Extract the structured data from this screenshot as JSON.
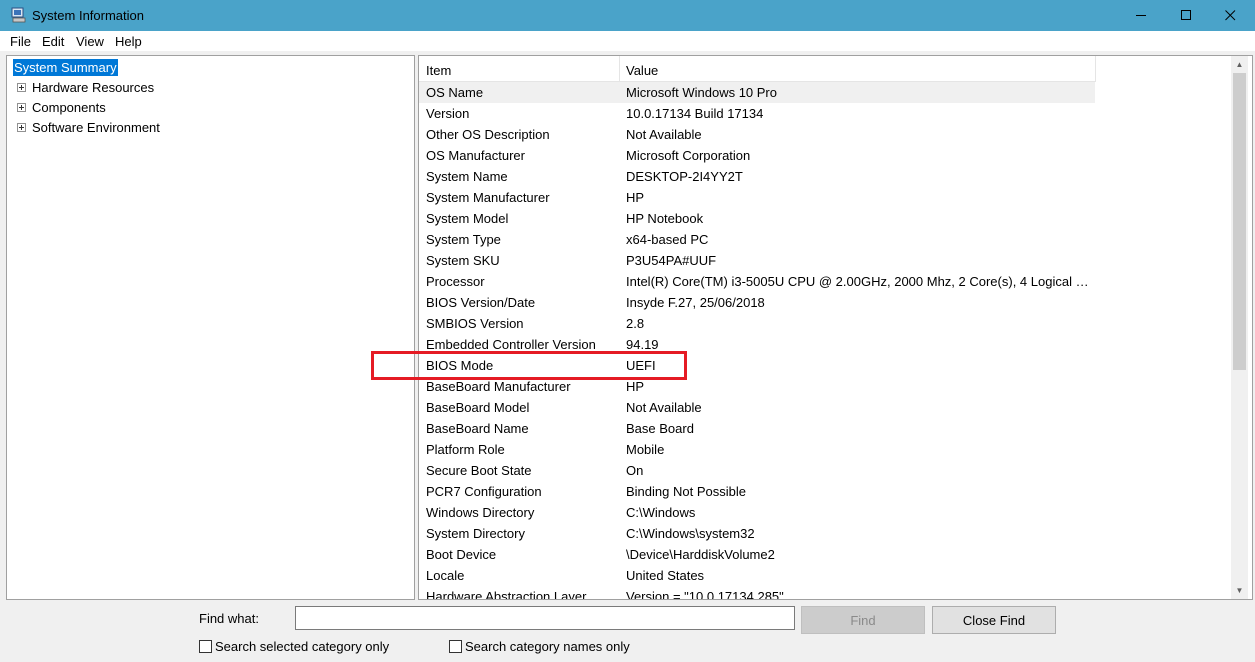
{
  "window": {
    "title": "System Information",
    "controls": {
      "minimize": "minimize",
      "maximize": "maximize",
      "close": "close"
    }
  },
  "menu": [
    "File",
    "Edit",
    "View",
    "Help"
  ],
  "tree": {
    "selected": "System Summary",
    "items": [
      "Hardware Resources",
      "Components",
      "Software Environment"
    ]
  },
  "table": {
    "columns": [
      "Item",
      "Value"
    ],
    "rows": [
      [
        "OS Name",
        "Microsoft Windows 10 Pro"
      ],
      [
        "Version",
        "10.0.17134 Build 17134"
      ],
      [
        "Other OS Description",
        "Not Available"
      ],
      [
        "OS Manufacturer",
        "Microsoft Corporation"
      ],
      [
        "System Name",
        "DESKTOP-2I4YY2T"
      ],
      [
        "System Manufacturer",
        "HP"
      ],
      [
        "System Model",
        "HP Notebook"
      ],
      [
        "System Type",
        "x64-based PC"
      ],
      [
        "System SKU",
        "P3U54PA#UUF"
      ],
      [
        "Processor",
        "Intel(R) Core(TM) i3-5005U CPU @ 2.00GHz, 2000 Mhz, 2 Core(s), 4 Logical Pr..."
      ],
      [
        "BIOS Version/Date",
        "Insyde F.27, 25/06/2018"
      ],
      [
        "SMBIOS Version",
        "2.8"
      ],
      [
        "Embedded Controller Version",
        "94.19"
      ],
      [
        "BIOS Mode",
        "UEFI"
      ],
      [
        "BaseBoard Manufacturer",
        "HP"
      ],
      [
        "BaseBoard Model",
        "Not Available"
      ],
      [
        "BaseBoard Name",
        "Base Board"
      ],
      [
        "Platform Role",
        "Mobile"
      ],
      [
        "Secure Boot State",
        "On"
      ],
      [
        "PCR7 Configuration",
        "Binding Not Possible"
      ],
      [
        "Windows Directory",
        "C:\\Windows"
      ],
      [
        "System Directory",
        "C:\\Windows\\system32"
      ],
      [
        "Boot Device",
        "\\Device\\HarddiskVolume2"
      ],
      [
        "Locale",
        "United States"
      ],
      [
        "Hardware Abstraction Layer",
        "Version = \"10.0.17134.285\""
      ]
    ]
  },
  "find": {
    "label": "Find what:",
    "value": "",
    "find_button": "Find",
    "close_button": "Close Find",
    "checkbox_selected": "Search selected category only",
    "checkbox_names": "Search category names only"
  },
  "colors": {
    "titlebar": "#4aa3c9",
    "selection": "#0078d7",
    "highlight_box": "#e51b24"
  }
}
